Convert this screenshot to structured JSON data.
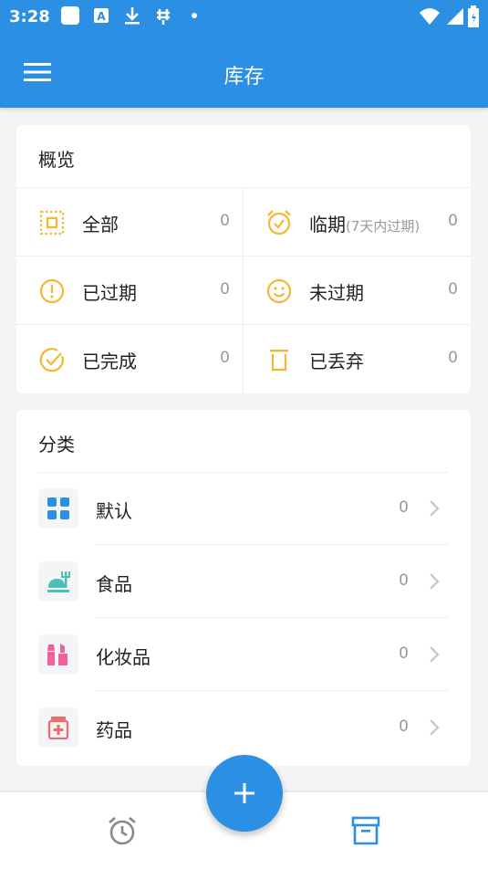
{
  "status_bar": {
    "time": "3:28",
    "icons": [
      "square-icon",
      "a-icon",
      "download-icon",
      "bug-icon",
      "dot-icon"
    ],
    "right_icons": [
      "wifi-icon",
      "signal-icon",
      "battery-icon"
    ]
  },
  "app_bar": {
    "title": "库存",
    "menu_icon": "menu-icon"
  },
  "overview": {
    "title": "概览",
    "items": [
      {
        "label": "全部",
        "sub": "",
        "count": "0",
        "icon": "all-icon"
      },
      {
        "label": "临期",
        "sub": "(7天内过期)",
        "count": "0",
        "icon": "alarm-icon"
      },
      {
        "label": "已过期",
        "sub": "",
        "count": "0",
        "icon": "exclamation-icon"
      },
      {
        "label": "未过期",
        "sub": "",
        "count": "0",
        "icon": "smile-icon"
      },
      {
        "label": "已完成",
        "sub": "",
        "count": "0",
        "icon": "check-circle-icon"
      },
      {
        "label": "已丢弃",
        "sub": "",
        "count": "0",
        "icon": "trash-icon"
      }
    ],
    "accent_color": "#f5b731"
  },
  "category": {
    "title": "分类",
    "items": [
      {
        "label": "默认",
        "count": "0",
        "icon": "grid-icon",
        "color": "#2b90e3"
      },
      {
        "label": "食品",
        "count": "0",
        "icon": "food-icon",
        "color": "#4cc0b5"
      },
      {
        "label": "化妆品",
        "count": "0",
        "icon": "cosmetics-icon",
        "color": "#f0629a"
      },
      {
        "label": "药品",
        "count": "0",
        "icon": "medicine-icon",
        "color": "#f06a6a"
      }
    ]
  },
  "bottom_nav": {
    "tabs": [
      {
        "name": "reminder",
        "icon": "alarm-clock-icon",
        "active": false
      },
      {
        "name": "inventory",
        "icon": "archive-box-icon",
        "active": true
      }
    ],
    "fab_icon": "plus-icon"
  },
  "colors": {
    "primary": "#2b90e3",
    "background": "#f3f4f6",
    "text": "#222222",
    "muted": "#999999"
  }
}
